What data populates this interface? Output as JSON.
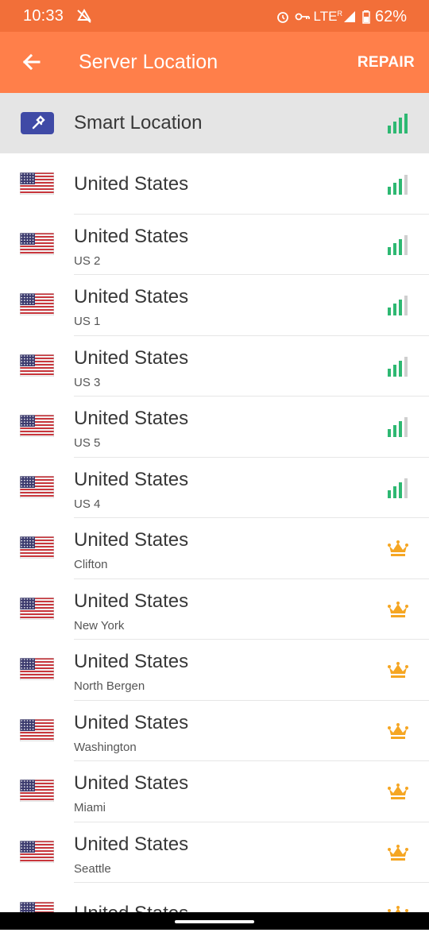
{
  "status": {
    "time": "10:33",
    "network": "LTE",
    "roaming": "R",
    "battery": "62%"
  },
  "appbar": {
    "title": "Server Location",
    "action": "REPAIR"
  },
  "smart": {
    "label": "Smart Location"
  },
  "locations": [
    {
      "country": "United States",
      "city": "",
      "tier": "free"
    },
    {
      "country": "United States",
      "city": "US 2",
      "tier": "free"
    },
    {
      "country": "United States",
      "city": "US 1",
      "tier": "free"
    },
    {
      "country": "United States",
      "city": "US 3",
      "tier": "free"
    },
    {
      "country": "United States",
      "city": "US 5",
      "tier": "free"
    },
    {
      "country": "United States",
      "city": "US 4",
      "tier": "free"
    },
    {
      "country": "United States",
      "city": "Clifton",
      "tier": "premium"
    },
    {
      "country": "United States",
      "city": "New York",
      "tier": "premium"
    },
    {
      "country": "United States",
      "city": "North Bergen",
      "tier": "premium"
    },
    {
      "country": "United States",
      "city": "Washington",
      "tier": "premium"
    },
    {
      "country": "United States",
      "city": "Miami",
      "tier": "premium"
    },
    {
      "country": "United States",
      "city": "Seattle",
      "tier": "premium"
    },
    {
      "country": "United States",
      "city": "",
      "tier": "premium"
    }
  ],
  "colors": {
    "statusbar": "#f26f39",
    "appbar": "#ff7f4a",
    "signal": "#2eb872",
    "crown": "#f5a623",
    "smart_icon": "#3f4aa6"
  }
}
